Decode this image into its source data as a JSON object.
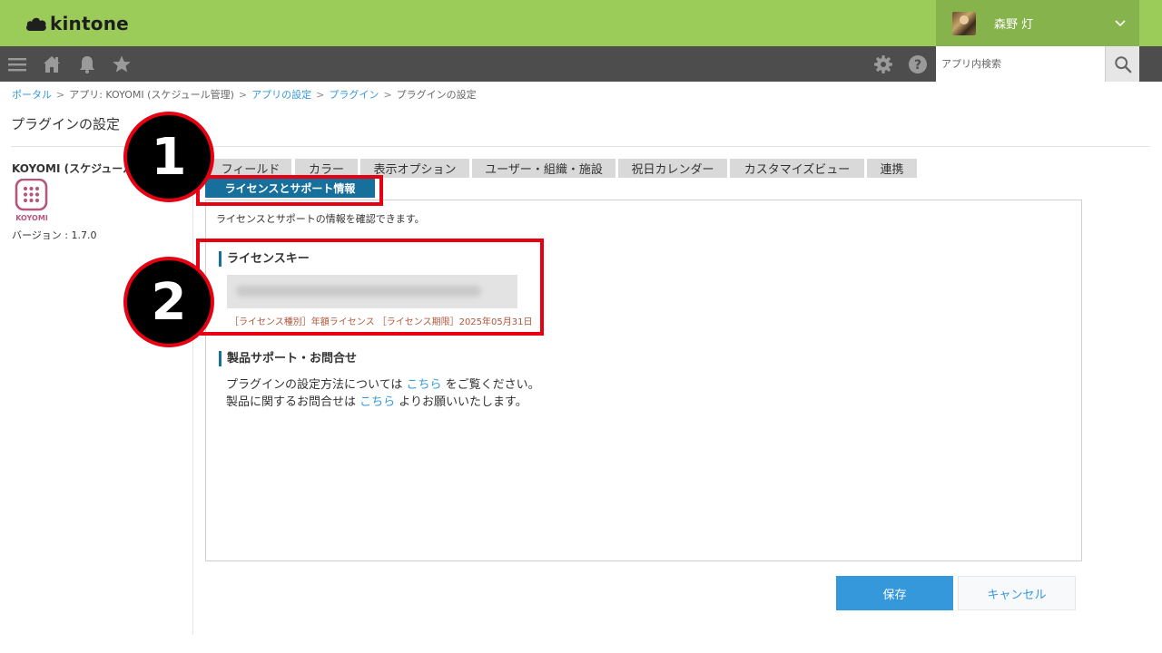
{
  "header": {
    "logo_text": "kintone",
    "user_name": "森野 灯"
  },
  "search": {
    "placeholder": "アプリ内検索"
  },
  "breadcrumb": {
    "portal": "ポータル",
    "app": "アプリ: KOYOMI (スケジュール管理)",
    "app_settings": "アプリの設定",
    "plugins": "プラグイン",
    "current": "プラグインの設定",
    "separator": ">"
  },
  "page": {
    "title": "プラグインの設定"
  },
  "sidebar": {
    "plugin_name": "KOYOMI (スケジュール管理)",
    "icon_label": "KOYOMI",
    "version": "バージョン : 1.7.0"
  },
  "tabs": [
    {
      "label": "フィールド"
    },
    {
      "label": "カラー"
    },
    {
      "label": "表示オプション"
    },
    {
      "label": "ユーザー・組織・施設"
    },
    {
      "label": "祝日カレンダー"
    },
    {
      "label": "カスタマイズビュー"
    },
    {
      "label": "連携"
    }
  ],
  "active_tab": {
    "label": "ライセンスとサポート情報"
  },
  "panel": {
    "description": "ライセンスとサポートの情報を確認できます。",
    "license_heading": "ライセンスキー",
    "license_info": "［ライセンス種別］年額ライセンス ［ライセンス期限］2025年05月31日",
    "support_heading": "製品サポート・お問合せ",
    "support_line1_pre": "プラグインの設定方法については ",
    "support_line1_link": "こちら",
    "support_line1_post": " をご覧ください。",
    "support_line2_pre": "製品に関するお問合せは ",
    "support_line2_link": "こちら",
    "support_line2_post": " よりお願いいたします。"
  },
  "buttons": {
    "save": "保存",
    "cancel": "キャンセル"
  },
  "annotations": {
    "badge1": "1",
    "badge2": "2"
  },
  "colors": {
    "header_green": "#9bcc5a",
    "nav_dark": "#4d4d4d",
    "accent_blue": "#3498db",
    "tab_active": "#176f9b",
    "highlight_red": "#e60012"
  },
  "icons": [
    "menu-icon",
    "home-icon",
    "bell-icon",
    "star-icon",
    "gear-icon",
    "help-icon",
    "search-icon",
    "chevron-down-icon",
    "koyomi-plugin-icon"
  ]
}
